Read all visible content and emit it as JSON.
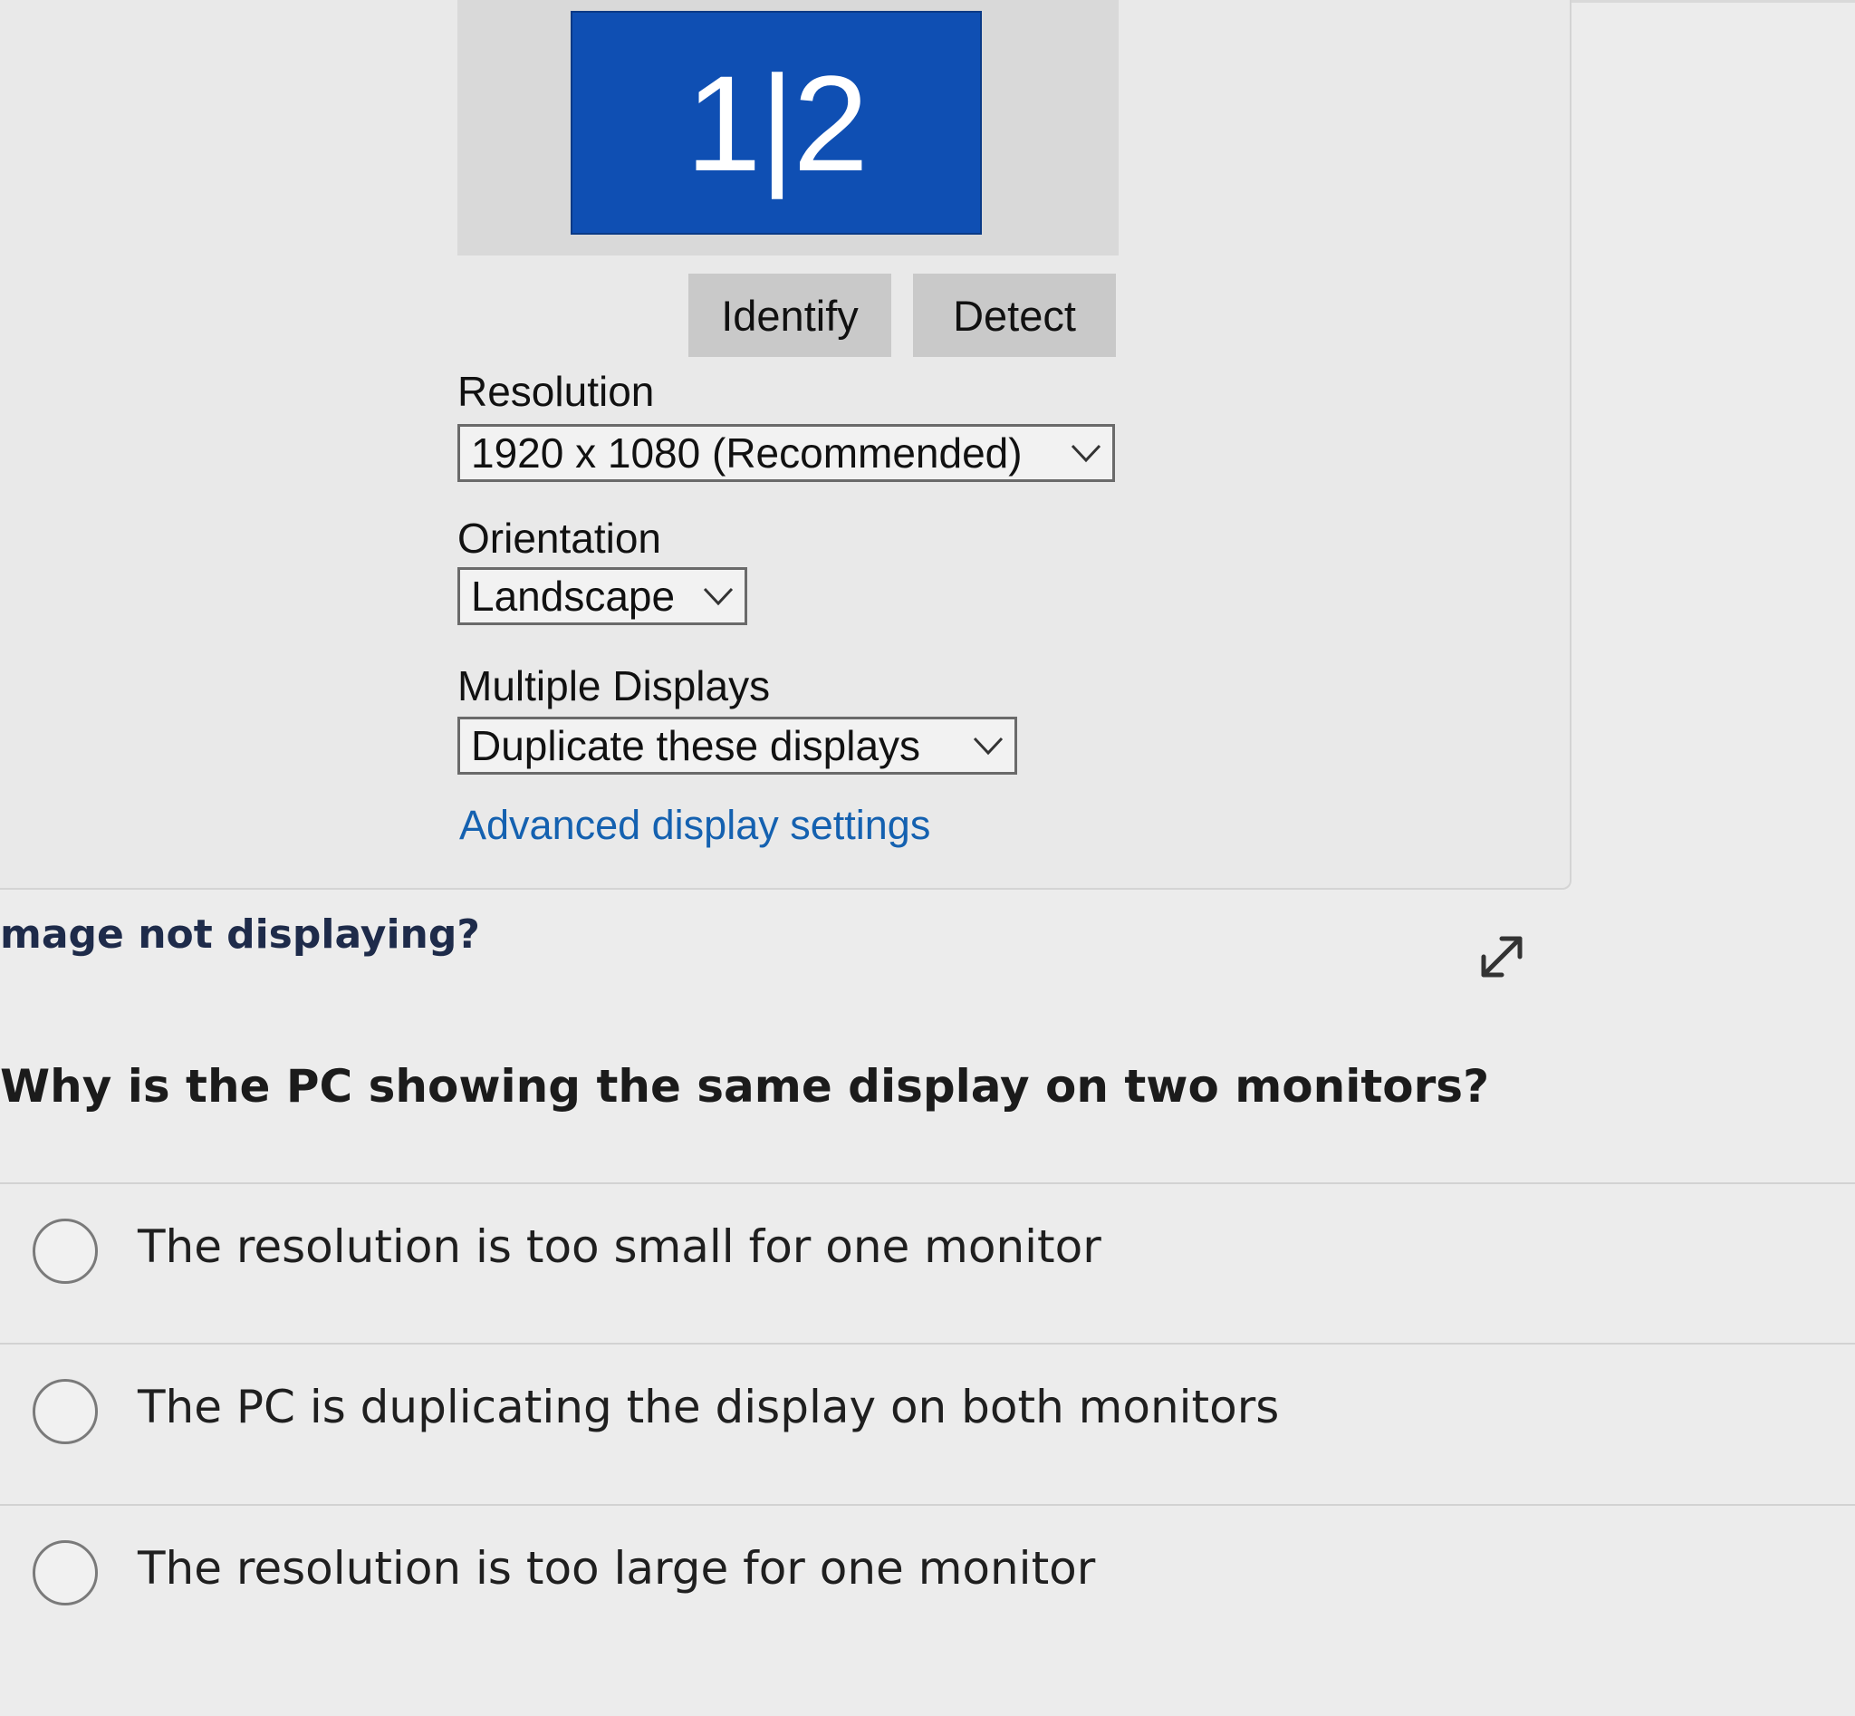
{
  "display_settings": {
    "monitor_label": "1|2",
    "identify_label": "Identify",
    "detect_label": "Detect",
    "resolution": {
      "label": "Resolution",
      "value": "1920 x 1080 (Recommended)"
    },
    "orientation": {
      "label": "Orientation",
      "value": "Landscape"
    },
    "multiple_displays": {
      "label": "Multiple Displays",
      "value": "Duplicate these displays"
    },
    "advanced_link": "Advanced display settings"
  },
  "image_note": "mage not displaying?",
  "question": "Why is the PC showing the same display on two monitors?",
  "options": [
    {
      "label": "The resolution is too small for one monitor"
    },
    {
      "label": "The PC is duplicating the display on both monitors"
    },
    {
      "label": "The resolution is too large for one monitor"
    }
  ],
  "colors": {
    "monitor_blue": "#0f4fb3",
    "link_blue": "#1461b0",
    "button_gray": "#c9c9c9"
  }
}
